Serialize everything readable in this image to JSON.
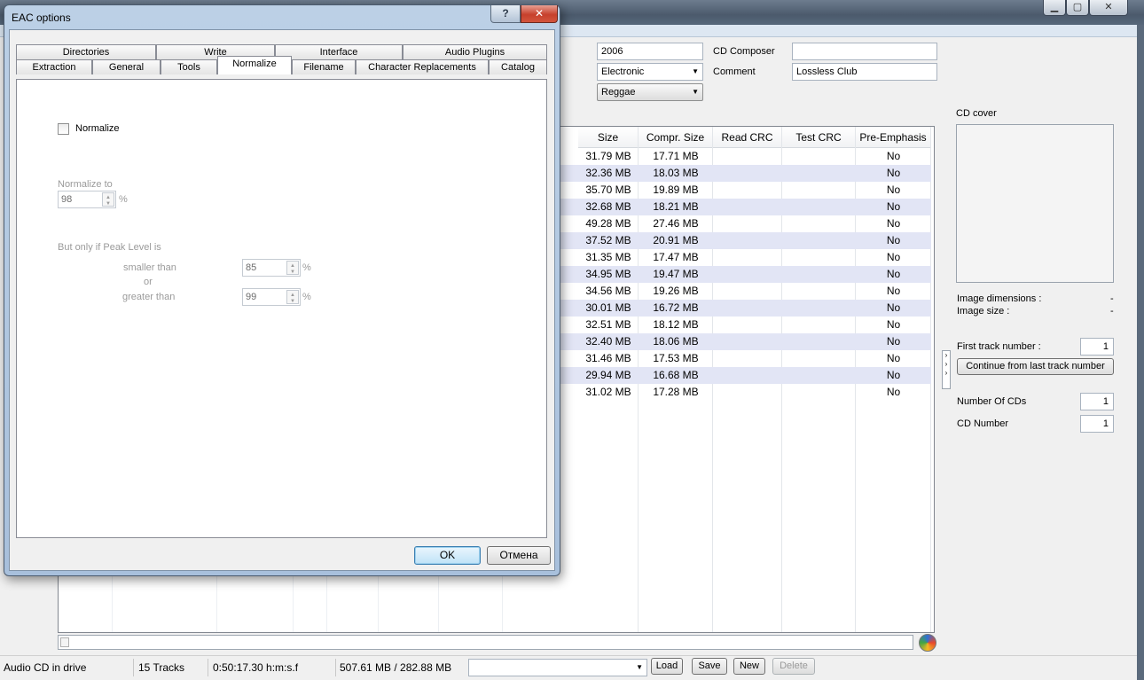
{
  "main": {
    "fields": {
      "year": "2006",
      "genre_select": "Electronic",
      "genre_alt_select": "Reggae",
      "cd_composer_label": "CD Composer",
      "cd_composer_value": "",
      "comment_label": "Comment",
      "comment_value": "Lossless Club"
    },
    "tracklist": {
      "columns": [
        "Size",
        "Compr. Size",
        "Read CRC",
        "Test CRC",
        "Pre-Emphasis"
      ],
      "rows": [
        {
          "size": "31.79 MB",
          "compr": "17.71 MB",
          "read_crc": "",
          "test_crc": "",
          "pre_emphasis": "No"
        },
        {
          "size": "32.36 MB",
          "compr": "18.03 MB",
          "read_crc": "",
          "test_crc": "",
          "pre_emphasis": "No"
        },
        {
          "size": "35.70 MB",
          "compr": "19.89 MB",
          "read_crc": "",
          "test_crc": "",
          "pre_emphasis": "No"
        },
        {
          "size": "32.68 MB",
          "compr": "18.21 MB",
          "read_crc": "",
          "test_crc": "",
          "pre_emphasis": "No"
        },
        {
          "size": "49.28 MB",
          "compr": "27.46 MB",
          "read_crc": "",
          "test_crc": "",
          "pre_emphasis": "No"
        },
        {
          "size": "37.52 MB",
          "compr": "20.91 MB",
          "read_crc": "",
          "test_crc": "",
          "pre_emphasis": "No"
        },
        {
          "size": "31.35 MB",
          "compr": "17.47 MB",
          "read_crc": "",
          "test_crc": "",
          "pre_emphasis": "No"
        },
        {
          "size": "34.95 MB",
          "compr": "19.47 MB",
          "read_crc": "",
          "test_crc": "",
          "pre_emphasis": "No"
        },
        {
          "size": "34.56 MB",
          "compr": "19.26 MB",
          "read_crc": "",
          "test_crc": "",
          "pre_emphasis": "No"
        },
        {
          "size": "30.01 MB",
          "compr": "16.72 MB",
          "read_crc": "",
          "test_crc": "",
          "pre_emphasis": "No"
        },
        {
          "size": "32.51 MB",
          "compr": "18.12 MB",
          "read_crc": "",
          "test_crc": "",
          "pre_emphasis": "No"
        },
        {
          "size": "32.40 MB",
          "compr": "18.06 MB",
          "read_crc": "",
          "test_crc": "",
          "pre_emphasis": "No"
        },
        {
          "size": "31.46 MB",
          "compr": "17.53 MB",
          "read_crc": "",
          "test_crc": "",
          "pre_emphasis": "No"
        },
        {
          "size": "29.94 MB",
          "compr": "16.68 MB",
          "read_crc": "",
          "test_crc": "",
          "pre_emphasis": "No"
        },
        {
          "size": "31.02 MB",
          "compr": "17.28 MB",
          "read_crc": "",
          "test_crc": "",
          "pre_emphasis": "No"
        }
      ]
    },
    "right_panel": {
      "cd_cover_label": "CD cover",
      "image_dimensions_label": "Image dimensions :",
      "image_dimensions_value": "-",
      "image_size_label": "Image size :",
      "image_size_value": "-",
      "first_track_label": "First track number :",
      "first_track_value": "1",
      "continue_button": "Continue from last track number",
      "number_of_cds_label": "Number Of CDs",
      "number_of_cds_value": "1",
      "cd_number_label": "CD Number",
      "cd_number_value": "1"
    },
    "statusbar": {
      "drive_status": "Audio CD in drive",
      "tracks": "15 Tracks",
      "duration": "0:50:17.30 h:m:s.f",
      "sizes": "507.61 MB / 282.88 MB",
      "profile_select": "",
      "load": "Load",
      "save": "Save",
      "new": "New",
      "delete": "Delete"
    }
  },
  "dialog": {
    "title": "EAC options",
    "help_glyph": "?",
    "close_glyph": "✕",
    "tabs_row1": [
      "Directories",
      "Write",
      "Interface",
      "Audio Plugins"
    ],
    "tabs_row2": [
      "Extraction",
      "General",
      "Tools",
      "Normalize",
      "Filename",
      "Character Replacements",
      "Catalog"
    ],
    "selected_tab": "Normalize",
    "normalize": {
      "checkbox_label": "Normalize",
      "checked": false,
      "normalize_to_label": "Normalize to",
      "normalize_to_value": "98",
      "percent": "%",
      "peak_label": "But only if Peak Level is",
      "smaller_than_label": "smaller than",
      "smaller_than_value": "85",
      "or_label": "or",
      "greater_than_label": "greater than",
      "greater_than_value": "99"
    },
    "ok_button": "OK",
    "cancel_button": "Отмена"
  },
  "colors": {
    "row_alt": "#e2e5f5",
    "dialog_frame": "#a8c0dc",
    "close_red": "#c7402c"
  }
}
